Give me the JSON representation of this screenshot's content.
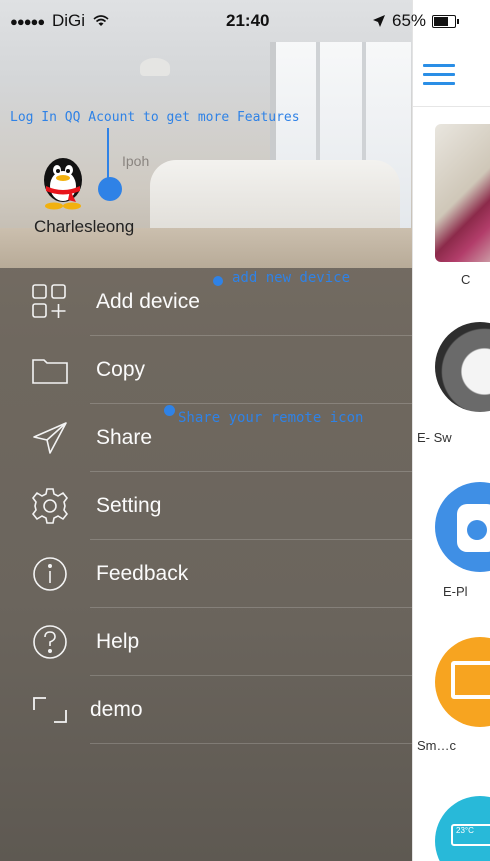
{
  "status_bar": {
    "signal_dots": "●●●●●",
    "carrier": "DiGi",
    "wifi_icon": "wifi-icon",
    "time": "21:40",
    "battery": "65%",
    "battery_level": 0.65
  },
  "drawer": {
    "login_hint": "Log In QQ Acount to get more Features",
    "avatar_icon": "qq-penguin-icon",
    "location": "Ipoh",
    "username": "Charlesleong",
    "add_hint": "add new device",
    "share_hint": "Share your remote icon",
    "menu": [
      {
        "label": "Add device",
        "icon": "add-device-icon"
      },
      {
        "label": "Copy",
        "icon": "folder-icon"
      },
      {
        "label": "Share",
        "icon": "paper-plane-icon"
      },
      {
        "label": "Setting",
        "icon": "gear-icon"
      },
      {
        "label": "Feedback",
        "icon": "info-icon"
      },
      {
        "label": "Help",
        "icon": "help-icon"
      },
      {
        "label": "demo",
        "icon": "expand-icon"
      }
    ]
  },
  "content": {
    "menu_icon": "hamburger-icon",
    "items": [
      {
        "label": "C"
      },
      {
        "label": "E- Sw"
      },
      {
        "label": "E-Pl"
      },
      {
        "label": "Sm…c"
      },
      {
        "label": "23°C"
      }
    ]
  },
  "colors": {
    "accent": "#2f82e6",
    "drawer_bg": "#6f685f",
    "plug_blue": "#3f8fe5",
    "tv_orange": "#f7a420",
    "ac_teal": "#28b9d9"
  }
}
